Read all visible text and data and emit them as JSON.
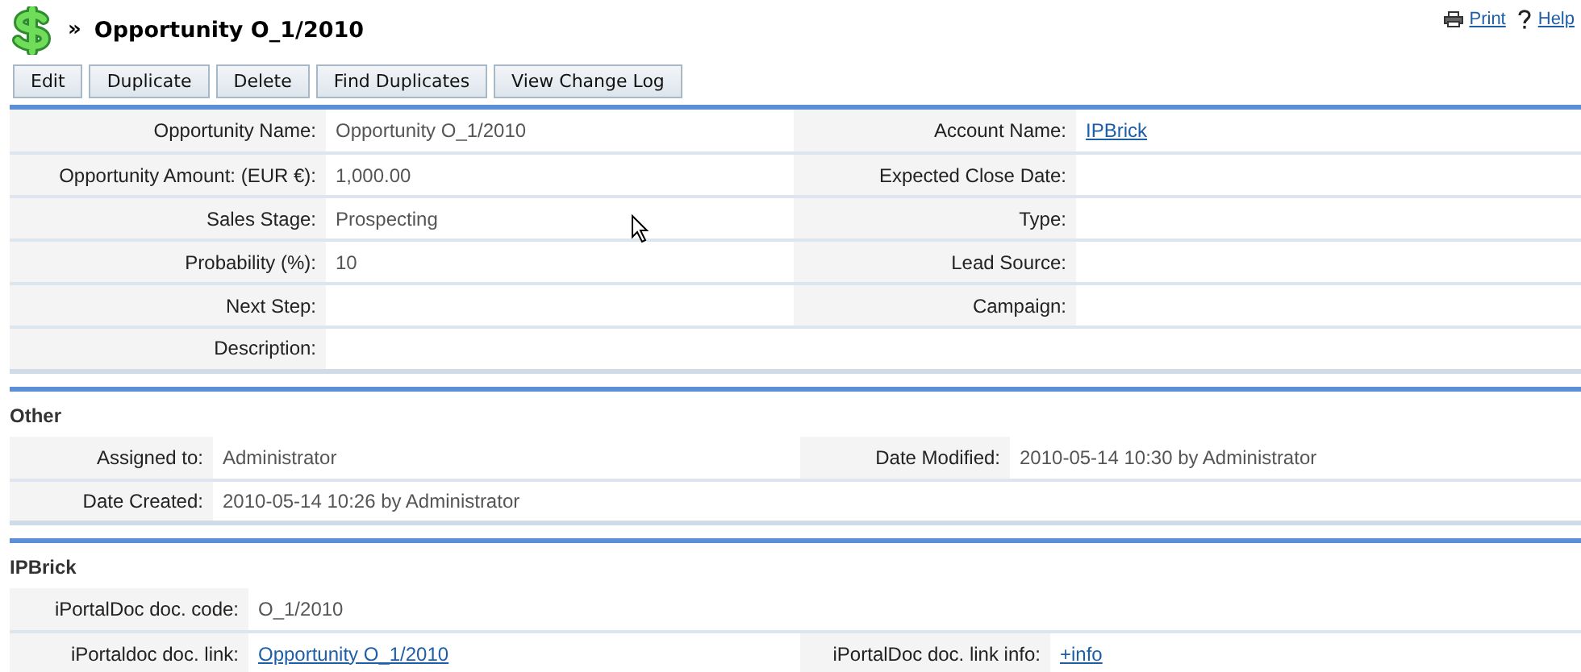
{
  "header": {
    "separator": "»",
    "title": "Opportunity O_1/2010",
    "links": [
      {
        "kind": "print",
        "label": "Print"
      },
      {
        "kind": "help",
        "label": "Help"
      }
    ]
  },
  "buttons": [
    "Edit",
    "Duplicate",
    "Delete",
    "Find Duplicates",
    "View Change Log"
  ],
  "panels": [
    {
      "rows": [
        [
          {
            "label": "Opportunity Name:",
            "value": "Opportunity O_1/2010",
            "kind": "text"
          },
          {
            "label": "Account Name:",
            "value": "IPBrick",
            "kind": "link"
          }
        ],
        [
          {
            "label": "Opportunity Amount: (EUR €):",
            "value": "1,000.00",
            "kind": "text"
          },
          {
            "label": "Expected Close Date:"
          }
        ],
        [
          {
            "label": "Sales Stage:",
            "value": "Prospecting",
            "kind": "text"
          },
          {
            "label": "Type:"
          }
        ],
        [
          {
            "label": "Probability (%):",
            "value": "10",
            "kind": "text"
          },
          {
            "label": "Lead Source:"
          }
        ],
        [
          {
            "label": "Next Step:"
          },
          {
            "label": "Campaign:"
          }
        ],
        [
          {
            "label": "Description:"
          }
        ]
      ]
    },
    {
      "title": "Other",
      "rows": [
        [
          {
            "label": "Assigned to:",
            "value": "Administrator",
            "kind": "text"
          },
          {
            "label": "Date Modified:",
            "value": "2010-05-14 10:30 by Administrator",
            "kind": "text"
          }
        ],
        [
          {
            "label": "Date Created:",
            "value": "2010-05-14 10:26 by Administrator",
            "kind": "text"
          }
        ]
      ]
    },
    {
      "title": "IPBrick",
      "rows": [
        [
          {
            "label": "iPortalDoc doc. code:",
            "value": "O_1/2010",
            "kind": "text"
          }
        ],
        [
          {
            "label": "iPortaldoc doc. link:",
            "value": "Opportunity O_1/2010",
            "kind": "link"
          },
          {
            "label": "iPortalDoc doc. link info:",
            "value": "+info",
            "kind": "link"
          }
        ]
      ]
    }
  ]
}
